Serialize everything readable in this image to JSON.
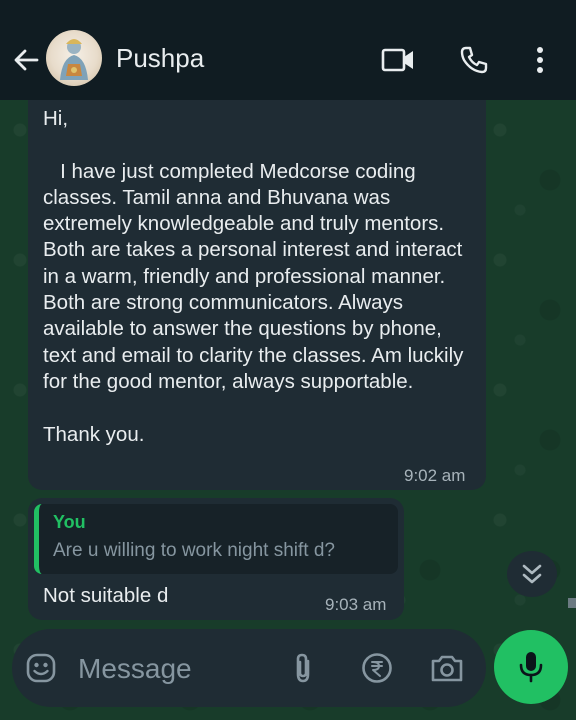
{
  "header": {
    "contact_name": "Pushpa",
    "icons": [
      "back-arrow-icon",
      "avatar",
      "video-call-icon",
      "voice-call-icon",
      "more-options-icon"
    ]
  },
  "messages": [
    {
      "direction": "incoming",
      "text": "Hi,\n\n   I have just completed Medcorse coding classes. Tamil anna and Bhuvana was extremely knowledgeable and truly mentors. Both are takes a personal interest and interact in a warm, friendly and professional manner. Both are strong communicators. Always available to answer the questions by phone, text and email to clarity the classes. Am luckily for the good mentor, always supportable.\n\nThank you.",
      "time": "9:02 am"
    },
    {
      "direction": "incoming",
      "quoted": {
        "sender": "You",
        "text": "Are u willing to work night shift d?"
      },
      "text": "Not suitable d",
      "time": "9:03 am"
    }
  ],
  "composer": {
    "placeholder": "Message",
    "icons": [
      "emoji-icon",
      "attach-icon",
      "rupee-payment-icon",
      "camera-icon",
      "mic-icon"
    ]
  },
  "colors": {
    "accent": "#21c063",
    "bubble": "#1f2c34",
    "header": "#101c22",
    "wallpaper": "#183c2a"
  }
}
